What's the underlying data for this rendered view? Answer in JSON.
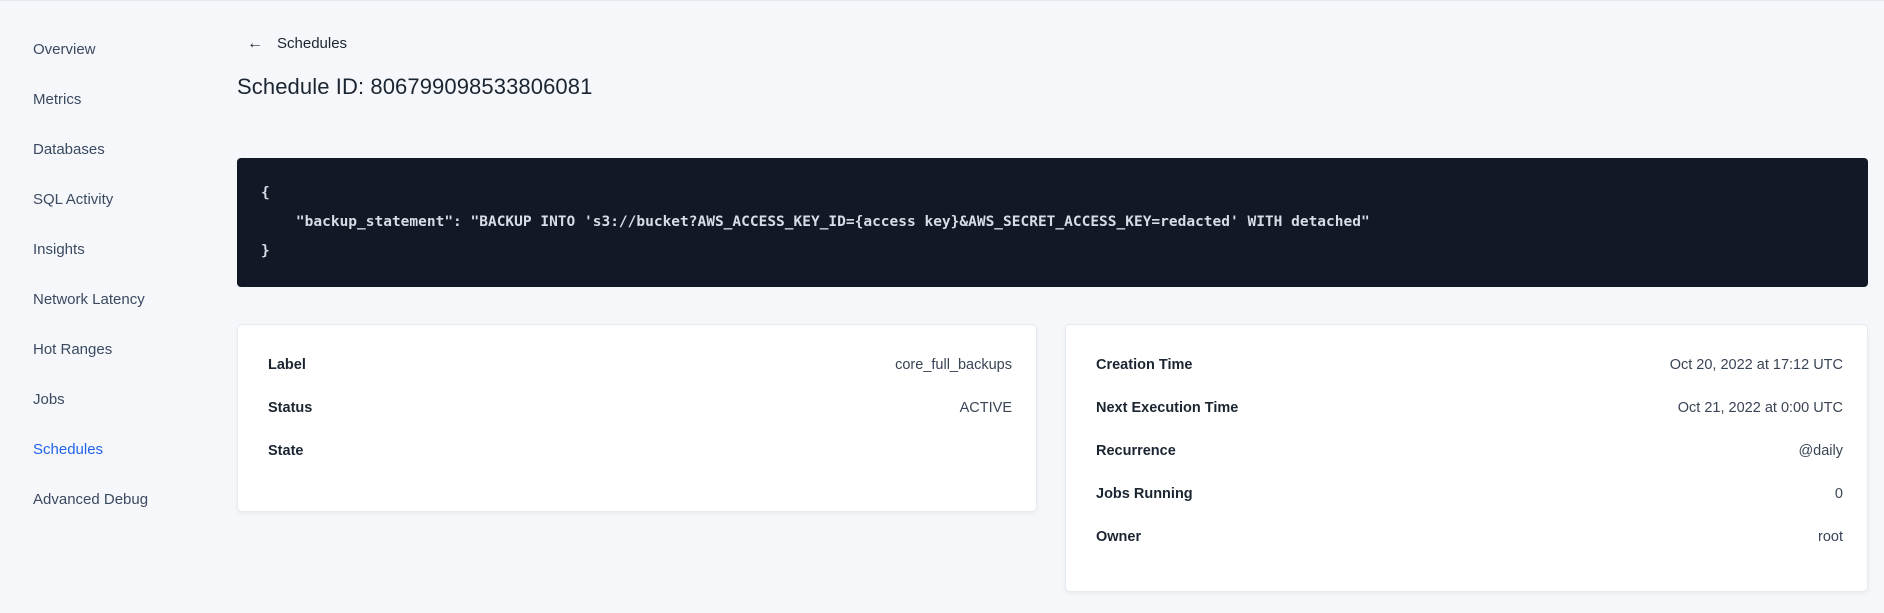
{
  "sidebar": {
    "items": [
      {
        "label": "Overview",
        "active": false
      },
      {
        "label": "Metrics",
        "active": false
      },
      {
        "label": "Databases",
        "active": false
      },
      {
        "label": "SQL Activity",
        "active": false
      },
      {
        "label": "Insights",
        "active": false
      },
      {
        "label": "Network Latency",
        "active": false
      },
      {
        "label": "Hot Ranges",
        "active": false
      },
      {
        "label": "Jobs",
        "active": false
      },
      {
        "label": "Schedules",
        "active": true
      },
      {
        "label": "Advanced Debug",
        "active": false
      }
    ]
  },
  "header": {
    "back_icon": "←",
    "back_label": "Schedules",
    "title": "Schedule ID: 806799098533806081"
  },
  "code_block": {
    "lines": {
      "open": "{",
      "statement": "    \"backup_statement\": \"BACKUP INTO 's3://bucket?AWS_ACCESS_KEY_ID={access key}&AWS_SECRET_ACCESS_KEY=redacted' WITH detached\"",
      "close": "}"
    }
  },
  "summary_card": {
    "rows": [
      {
        "label": "Label",
        "value": "core_full_backups"
      },
      {
        "label": "Status",
        "value": "ACTIVE"
      },
      {
        "label": "State",
        "value": ""
      }
    ]
  },
  "schedule_card": {
    "rows": [
      {
        "label": "Creation Time",
        "value": "Oct 20, 2022 at 17:12 UTC"
      },
      {
        "label": "Next Execution Time",
        "value": "Oct 21, 2022 at 0:00 UTC"
      },
      {
        "label": "Recurrence",
        "value": "@daily"
      },
      {
        "label": "Jobs Running",
        "value": "0"
      },
      {
        "label": "Owner",
        "value": "root"
      }
    ]
  },
  "colors": {
    "page_background": "#f5f7fa",
    "active_nav": "#2263eb",
    "code_background": "#121826",
    "code_text": "#d7dce6",
    "heading_text": "#1b2531"
  }
}
